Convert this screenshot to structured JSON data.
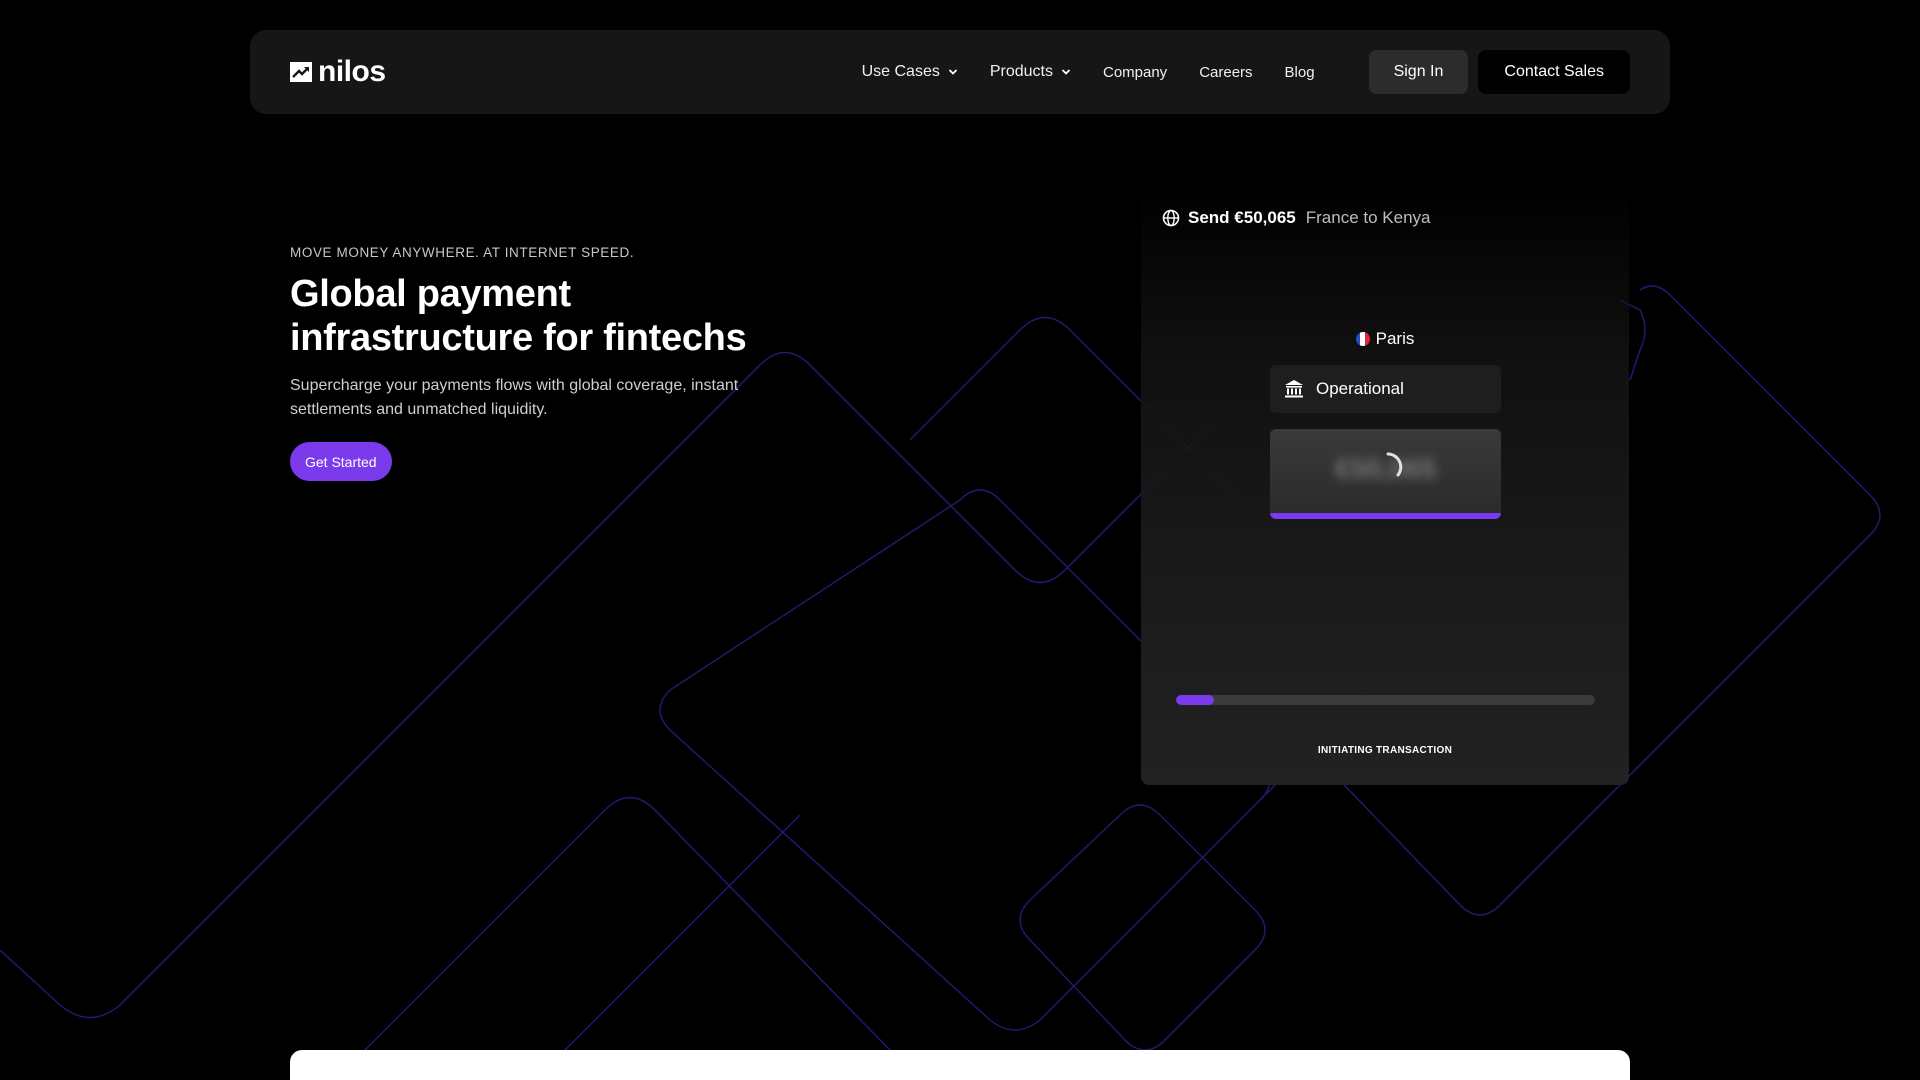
{
  "nav": {
    "logo_text": "nilos",
    "links": [
      {
        "label": "Use Cases",
        "dropdown": true
      },
      {
        "label": "Products",
        "dropdown": true
      },
      {
        "label": "Company"
      },
      {
        "label": "Careers"
      },
      {
        "label": "Blog"
      }
    ],
    "sign_in_label": "Sign In",
    "contact_label": "Contact Sales"
  },
  "hero": {
    "eyebrow": "MOVE MONEY ANYWHERE. AT INTERNET SPEED.",
    "headline_line1": "Global payment",
    "headline_line2": "infrastructure for fintechs",
    "subtext_line1": "Supercharge your payments flows with global coverage, instant",
    "subtext_line2": "settlements and unmatched liquidity.",
    "cta_label": "Get Started"
  },
  "transaction": {
    "send_label": "Send €50,065",
    "route": "France to Kenya",
    "city": "Paris",
    "status": "Operational",
    "amount_blurred": "€50,065",
    "progress": 0.09,
    "progress_label": "INITIATING TRANSACTION"
  },
  "colors": {
    "accent": "#7c3aed",
    "background": "#000000",
    "nav_bg": "#161616"
  },
  "icons": {
    "logo": "nilos-logo-icon",
    "globe": "globe-icon",
    "bank": "bank-icon",
    "spinner": "spinner-icon",
    "chevron": "chevron-down-icon",
    "flag": "france-flag-icon"
  }
}
